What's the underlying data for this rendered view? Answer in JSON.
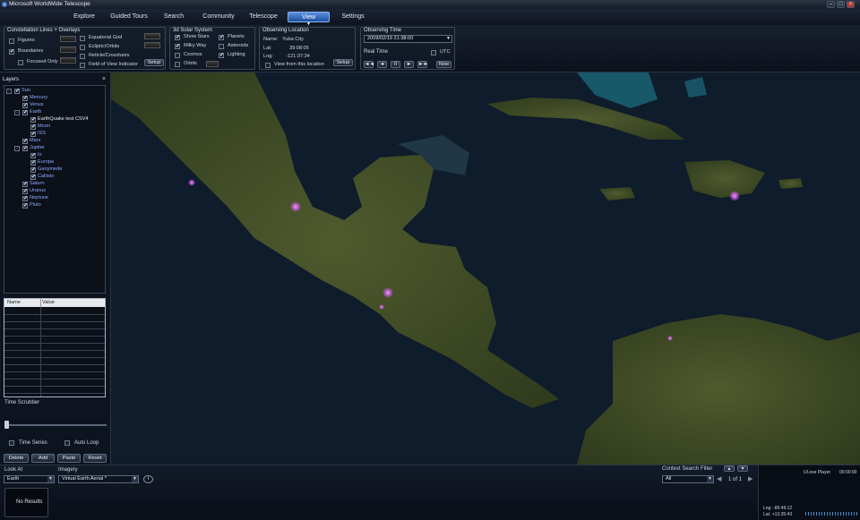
{
  "window": {
    "title": "Microsoft WorldWide Telescope",
    "min": "–",
    "max": "□",
    "close": "×"
  },
  "tabs": [
    {
      "label": "Explore"
    },
    {
      "label": "Guided Tours"
    },
    {
      "label": "Search"
    },
    {
      "label": "Community"
    },
    {
      "label": "Telescope"
    },
    {
      "label": "View",
      "active": true
    },
    {
      "label": "Settings"
    }
  ],
  "constellation": {
    "title": "Constellation Lines + Overlays",
    "figures": {
      "label": "Figures",
      "checked": false
    },
    "boundaries": {
      "label": "Boundaries",
      "checked": true
    },
    "focused_only": {
      "label": "Focused Only",
      "checked": false
    },
    "equatorial_grid": {
      "label": "Equatorial Grid",
      "checked": false
    },
    "ecliptic_orbits": {
      "label": "Ecliptic/Orbits",
      "checked": false
    },
    "reticle": {
      "label": "Reticle/Crosshairs",
      "checked": false
    },
    "fov_indicator": {
      "label": "Field of View Indicator",
      "checked": false
    },
    "setup": "Setup"
  },
  "solar": {
    "title": "3d Solar System",
    "show_stars": {
      "label": "Show Stars",
      "checked": true
    },
    "milky_way": {
      "label": "Milky Way",
      "checked": true
    },
    "cosmos": {
      "label": "Cosmos",
      "checked": false
    },
    "orbits": {
      "label": "Orbits",
      "checked": false
    },
    "planets": {
      "label": "Planets",
      "checked": true
    },
    "asteroids": {
      "label": "Asteroids",
      "checked": false
    },
    "lighting": {
      "label": "Lighting",
      "checked": true
    }
  },
  "location": {
    "title": "Observing Location",
    "name_label": "Name:",
    "name": "Yuba City",
    "lat_label": "Lat:",
    "lat": "39:08:05",
    "lng_label": "Lng:",
    "lng": "-121:37:34",
    "view_from": {
      "label": "View from this location",
      "checked": false
    },
    "setup": "Setup"
  },
  "time": {
    "title": "Observing Time",
    "datetime": "2009/02/19   21:38:00",
    "real_time": "Real Time",
    "utc": {
      "label": "UTC",
      "checked": false
    },
    "controls": [
      "◄◄",
      "◄",
      "II",
      "►",
      "►►"
    ],
    "now": "Now"
  },
  "layers": {
    "title": "Layers",
    "close": "×",
    "tree": [
      {
        "label": "Sun",
        "level": 0,
        "expand": "-"
      },
      {
        "label": "Mercury",
        "level": 1
      },
      {
        "label": "Venus",
        "level": 1
      },
      {
        "label": "Earth",
        "level": 1,
        "expand": "-"
      },
      {
        "label": "EarthQuake test CSV4",
        "level": 2,
        "white": true
      },
      {
        "label": "Moon",
        "level": 2
      },
      {
        "label": "ISS",
        "level": 2
      },
      {
        "label": "Mars",
        "level": 1
      },
      {
        "label": "Jupiter",
        "level": 1,
        "expand": "-"
      },
      {
        "label": "Io",
        "level": 2
      },
      {
        "label": "Europa",
        "level": 2
      },
      {
        "label": "Ganymede",
        "level": 2
      },
      {
        "label": "Callisto",
        "level": 2
      },
      {
        "label": "Saturn",
        "level": 1
      },
      {
        "label": "Uranus",
        "level": 1
      },
      {
        "label": "Neptune",
        "level": 1
      },
      {
        "label": "Pluto",
        "level": 1
      }
    ]
  },
  "props_grid": {
    "col_name": "Name",
    "col_value": "Value"
  },
  "scrubber": {
    "label": "Time Scrubber",
    "position": 0.0
  },
  "time_series": {
    "label": "Time Series",
    "checked": false
  },
  "auto_loop": {
    "label": "Auto Loop",
    "checked": false
  },
  "layer_buttons": [
    "Delete",
    "Add",
    "Paste",
    "Reset"
  ],
  "bottom": {
    "look_at_label": "Look At",
    "look_at": "Earth",
    "imagery_label": "Imagery",
    "imagery": "Virtual Earth Aerial *",
    "context_label": "Context Search Filter",
    "context": "All",
    "paging": "1 of 1",
    "no_results": "No Results",
    "ui_player": "UI.exe Player",
    "player_time": "00:00:00",
    "lng": "Lng:  -86:49:12",
    "lat": "Lat:  +13:35:43"
  },
  "colors": {
    "accent": "#2a63c4",
    "marker": "#e060ff",
    "tree_text": "#8ea8ff"
  }
}
